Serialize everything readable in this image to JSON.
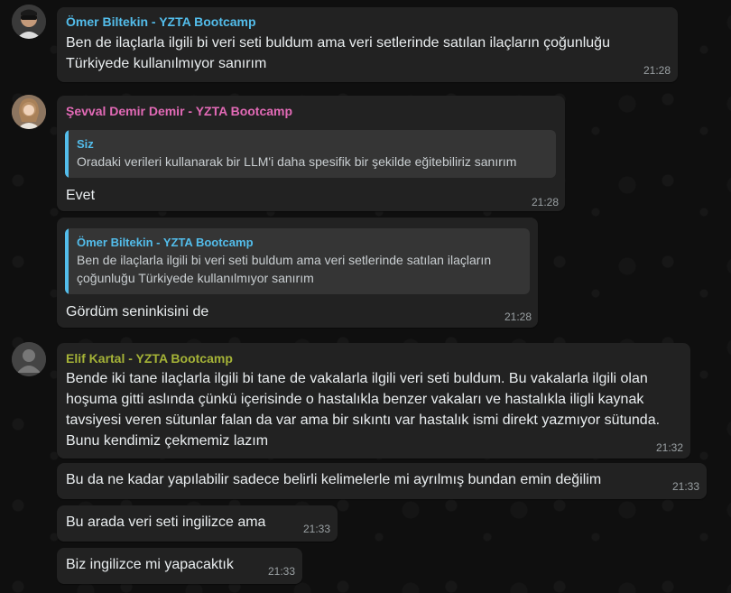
{
  "colors": {
    "omer": "#53bdeb",
    "sevval": "#e26ab6",
    "elif": "#a5b337",
    "quote_siz": "#53bdeb"
  },
  "messages": {
    "m1": {
      "sender": "Ömer Biltekin - YZTA Bootcamp",
      "text": "Ben de ilaçlarla ilgili bi veri seti buldum ama veri setlerinde satılan ilaçların çoğunluğu Türkiyede kullanılmıyor sanırım",
      "time": "21:28"
    },
    "m2": {
      "sender": "Şevval Demir Demir - YZTA Bootcamp",
      "quote_name": "Siz",
      "quote_text": "Oradaki verileri kullanarak bir LLM'i daha spesifik bir şekilde eğitebiliriz sanırım",
      "text": "Evet",
      "time": "21:28"
    },
    "m3": {
      "quote_name": "Ömer Biltekin - YZTA Bootcamp",
      "quote_text": "Ben de ilaçlarla ilgili bi veri seti buldum ama veri setlerinde satılan ilaçların çoğunluğu Türkiyede kullanılmıyor sanırım",
      "text": "Gördüm seninkisini de",
      "time": "21:28"
    },
    "m4": {
      "sender": "Elif Kartal - YZTA Bootcamp",
      "text": "Bende iki tane ilaçlarla ilgili bi tane de vakalarla ilgili veri seti buldum. Bu vakalarla ilgili olan hoşuma gitti aslında çünkü içerisinde o hastalıkla benzer vakaları ve hastalıkla iligli kaynak tavsiyesi veren sütunlar falan da var ama bir sıkıntı var hastalık ismi direkt yazmıyor sütunda. Bunu kendimiz çekmemiz lazım",
      "time": "21:32"
    },
    "m5": {
      "text": "Bu da ne kadar yapılabilir sadece belirli kelimelerle mi ayrılmış bundan emin değilim",
      "time": "21:33"
    },
    "m6": {
      "text": "Bu arada veri seti ingilizce ama",
      "time": "21:33"
    },
    "m7": {
      "text": "Biz ingilizce mi yapacaktık",
      "time": "21:33"
    }
  }
}
